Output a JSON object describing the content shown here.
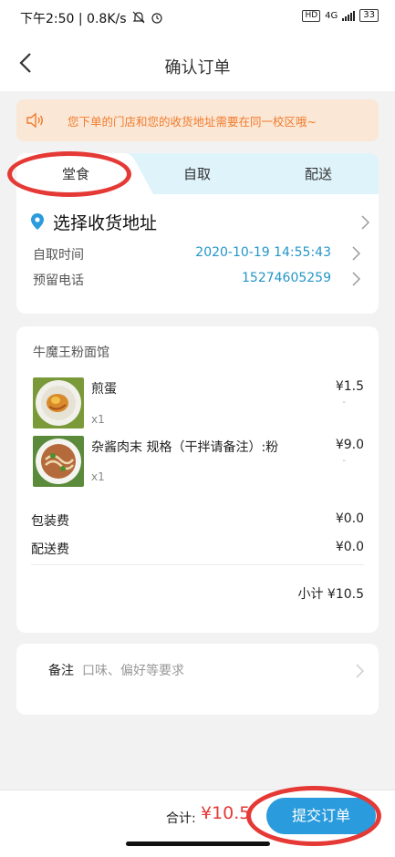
{
  "status_bar": {
    "time_speed": "下午2:50 | 0.8K/s",
    "hd": "HD",
    "network": "4G",
    "battery": "33"
  },
  "nav": {
    "title": "确认订单"
  },
  "notice": {
    "text": "您下单的门店和您的收货地址需要在同一校区哦~"
  },
  "tabs": {
    "items": [
      "堂食",
      "自取",
      "配送"
    ],
    "active": "堂食"
  },
  "address": {
    "label": "选择收货地址"
  },
  "pickup_time": {
    "label": "自取时间",
    "value": "2020-10-19 14:55:43"
  },
  "phone": {
    "label": "预留电话",
    "value": "15274605259"
  },
  "order": {
    "shop_name": "牛魔王粉面馆",
    "items": [
      {
        "name": "煎蛋",
        "qty": "x1",
        "price": "¥1.5",
        "dash": "-"
      },
      {
        "name": "杂酱肉末  规格（干拌请备注）:粉",
        "qty": "x1",
        "price": "¥9.0",
        "dash": "-"
      }
    ],
    "fees": [
      {
        "label": "包装费",
        "value": "¥0.0"
      },
      {
        "label": "配送费",
        "value": "¥0.0"
      }
    ],
    "subtotal": "小计 ¥10.5"
  },
  "remark": {
    "label": "备注",
    "placeholder": "口味、偏好等要求"
  },
  "footer": {
    "total_label": "合计:",
    "total_value": "¥10.5",
    "submit_label": "提交订单"
  },
  "colors": {
    "accent": "#2a9bdc",
    "link": "#2496c8",
    "notice_text": "#f07b2c",
    "notice_bg": "#fbe7d6",
    "tab_bg": "#dff3fb",
    "price_red": "#e53935",
    "annotation_ring": "#e53935"
  },
  "icons": {
    "back": "chevron-left-icon",
    "speaker": "speaker-icon",
    "location": "location-pin-icon",
    "row_arrow": "chevron-right-icon"
  }
}
